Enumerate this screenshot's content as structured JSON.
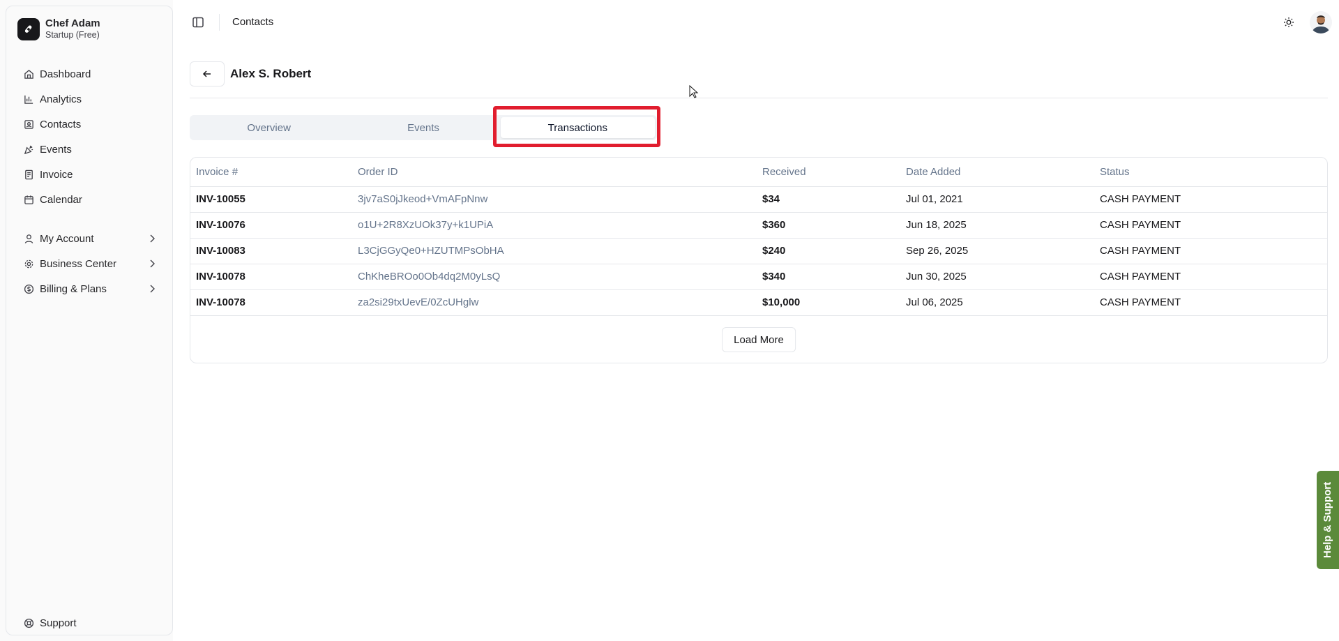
{
  "sidebar": {
    "brand_name": "Chef Adam",
    "brand_plan": "Startup (Free)",
    "items": [
      {
        "label": "Dashboard",
        "icon": "home-icon"
      },
      {
        "label": "Analytics",
        "icon": "bar-chart-icon"
      },
      {
        "label": "Contacts",
        "icon": "contact-icon"
      },
      {
        "label": "Events",
        "icon": "party-icon"
      },
      {
        "label": "Invoice",
        "icon": "invoice-icon"
      },
      {
        "label": "Calendar",
        "icon": "calendar-icon"
      }
    ],
    "expandable": [
      {
        "label": "My Account",
        "icon": "user-icon"
      },
      {
        "label": "Business Center",
        "icon": "gear-icon"
      },
      {
        "label": "Billing & Plans",
        "icon": "dollar-icon"
      }
    ],
    "support_label": "Support"
  },
  "header": {
    "title": "Contacts"
  },
  "contact": {
    "name": "Alex S. Robert"
  },
  "tabs": [
    "Overview",
    "Events",
    "Transactions"
  ],
  "table": {
    "headers": [
      "Invoice #",
      "Order ID",
      "Received",
      "Date Added",
      "Status"
    ],
    "rows": [
      [
        "INV-10055",
        "3jv7aS0jJkeod+VmAFpNnw",
        "$34",
        "Jul 01, 2021",
        "CASH PAYMENT"
      ],
      [
        "INV-10076",
        "o1U+2R8XzUOk37y+k1UPiA",
        "$360",
        "Jun 18, 2025",
        "CASH PAYMENT"
      ],
      [
        "INV-10083",
        "L3CjGGyQe0+HZUTMPsObHA",
        "$240",
        "Sep 26, 2025",
        "CASH PAYMENT"
      ],
      [
        "INV-10078",
        "ChKheBROo0Ob4dq2M0yLsQ",
        "$340",
        "Jun 30, 2025",
        "CASH PAYMENT"
      ],
      [
        "INV-10078",
        "za2si29txUevE/0ZcUHglw",
        "$10,000",
        "Jul 06, 2025",
        "CASH PAYMENT"
      ]
    ],
    "load_more_label": "Load More"
  },
  "help_label": "Help & Support",
  "colors": {
    "highlight": "#e11d2e",
    "help_bg": "#5b8a3a"
  }
}
